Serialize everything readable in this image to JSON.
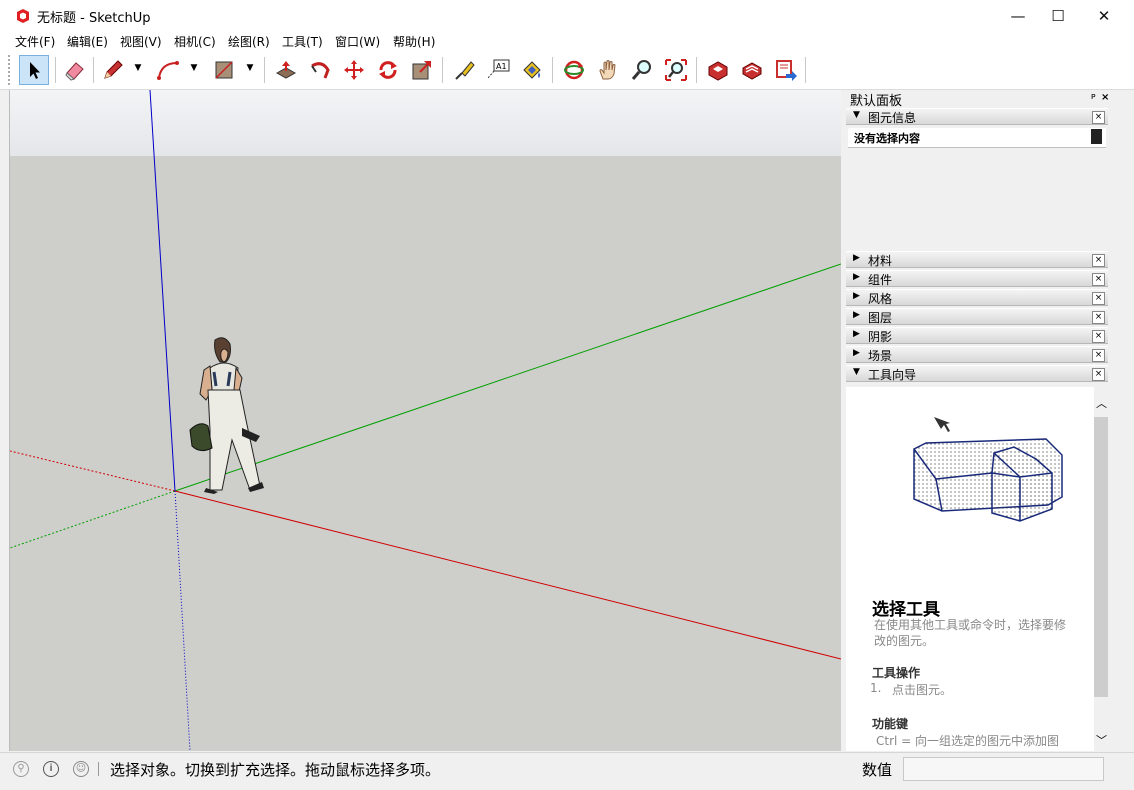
{
  "window": {
    "title": "无标题 - SketchUp",
    "minimize": "—",
    "maximize": "☐",
    "close": "✕"
  },
  "menu": [
    "文件(F)",
    "编辑(E)",
    "视图(V)",
    "相机(C)",
    "绘图(R)",
    "工具(T)",
    "窗口(W)",
    "帮助(H)"
  ],
  "toolbar": {
    "tools": [
      "select-tool",
      "eraser-tool",
      "line-tool",
      "arc-tool",
      "rectangle-tool",
      "push-pull-tool",
      "follow-me-tool",
      "move-tool",
      "rotate-tool",
      "scale-tool",
      "tape-measure-tool",
      "text-tool",
      "paint-bucket-tool",
      "orbit-tool",
      "pan-tool",
      "zoom-tool",
      "zoom-extents-tool",
      "3d-warehouse",
      "extension-warehouse",
      "send-to-layout"
    ],
    "text_tool_label": "A1"
  },
  "panel": {
    "title": "默认面板",
    "pin": "ᴘ",
    "close": "×",
    "entity_info": {
      "label": "图元信息",
      "status": "没有选择内容"
    },
    "trays": [
      {
        "label": "材料"
      },
      {
        "label": "组件"
      },
      {
        "label": "风格"
      },
      {
        "label": "图层"
      },
      {
        "label": "阴影"
      },
      {
        "label": "场景"
      }
    ],
    "instructor": {
      "label": "工具向导",
      "title": "选择工具",
      "description": "在使用其他工具或命令时，选择要修改的图元。",
      "section_ops": "工具操作",
      "op_1_num": "1.",
      "op_1": "点击图元。",
      "section_keys": "功能键",
      "key_1": "Ctrl = 向一组选定的图元中添加图"
    }
  },
  "status": {
    "message": "选择对象。切换到扩充选择。拖动鼠标选择多项。",
    "measure_label": "数值",
    "measure_value": ""
  },
  "colors": {
    "red_axis": "#d00000",
    "green_axis": "#00a000",
    "blue_axis": "#0000c8",
    "ground": "#cececb",
    "sky": "#e8eaed"
  }
}
